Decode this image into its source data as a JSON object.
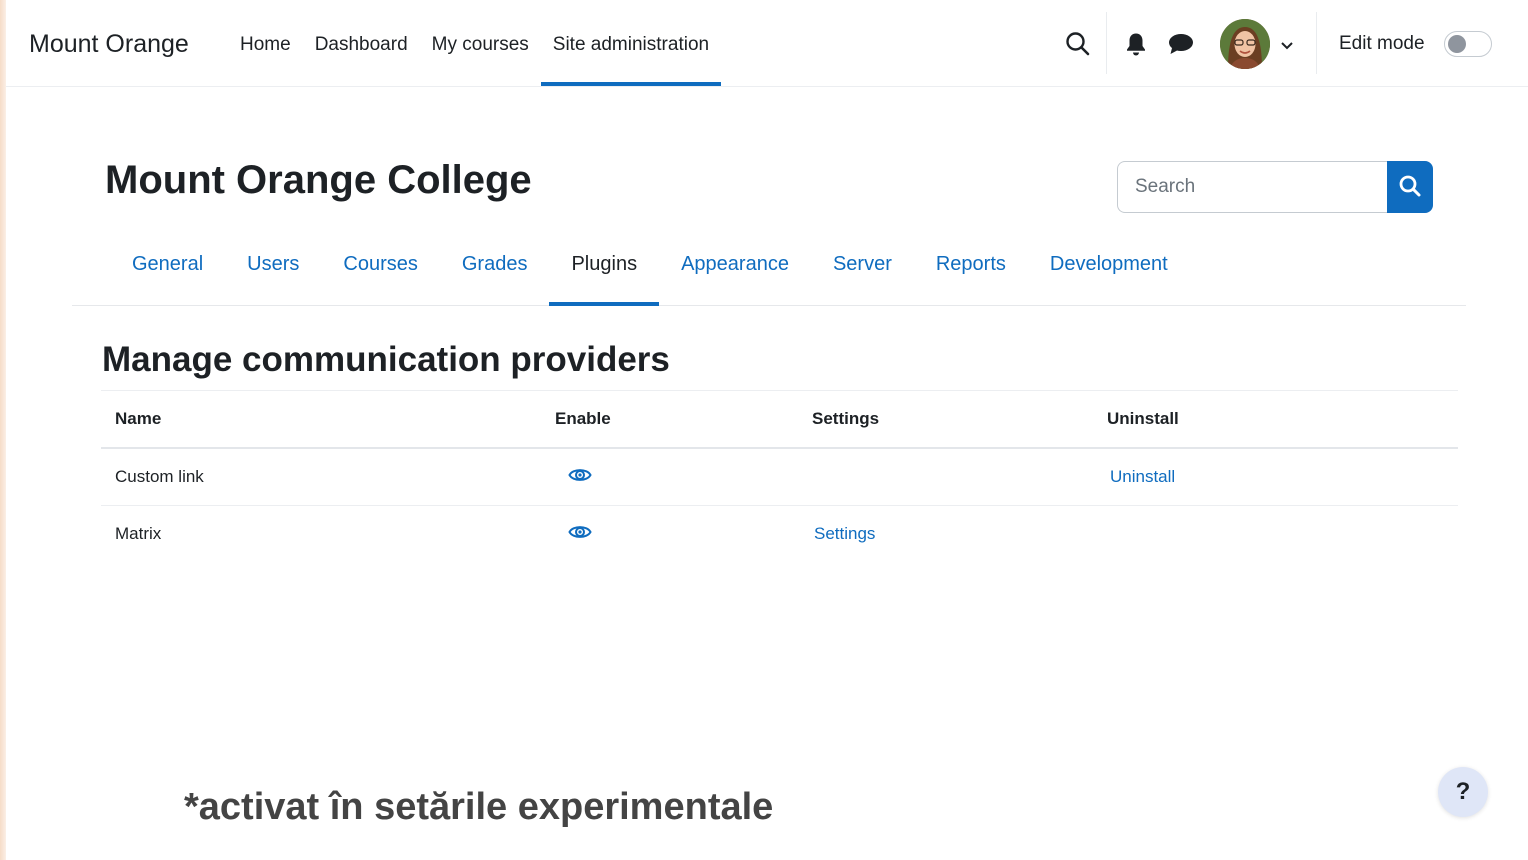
{
  "navbar": {
    "brand": "Mount Orange",
    "items": [
      {
        "label": "Home",
        "active": false
      },
      {
        "label": "Dashboard",
        "active": false
      },
      {
        "label": "My courses",
        "active": false
      },
      {
        "label": "Site administration",
        "active": true
      }
    ],
    "icons": [
      "search-icon",
      "bell-icon",
      "chat-icon",
      "avatar",
      "chevron-down-icon"
    ],
    "edit_mode_label": "Edit mode",
    "edit_mode_on": false
  },
  "header": {
    "title": "Mount Orange College",
    "search_placeholder": "Search"
  },
  "tabs": [
    {
      "label": "General",
      "active": false
    },
    {
      "label": "Users",
      "active": false
    },
    {
      "label": "Courses",
      "active": false
    },
    {
      "label": "Grades",
      "active": false
    },
    {
      "label": "Plugins",
      "active": true
    },
    {
      "label": "Appearance",
      "active": false
    },
    {
      "label": "Server",
      "active": false
    },
    {
      "label": "Reports",
      "active": false
    },
    {
      "label": "Development",
      "active": false
    }
  ],
  "section": {
    "title": "Manage communication providers",
    "columns": {
      "name": "Name",
      "enable": "Enable",
      "settings": "Settings",
      "uninstall": "Uninstall"
    },
    "rows": [
      {
        "name": "Custom link",
        "enabled_icon": "eye-icon",
        "settings": "",
        "uninstall": "Uninstall"
      },
      {
        "name": "Matrix",
        "enabled_icon": "eye-icon",
        "settings": "Settings",
        "uninstall": ""
      }
    ]
  },
  "footer_note": "*activat în setările experimentale",
  "help_label": "?",
  "colors": {
    "accent": "#0f6cbf",
    "text": "#1d2125",
    "help_bg": "#dfe6f7"
  }
}
